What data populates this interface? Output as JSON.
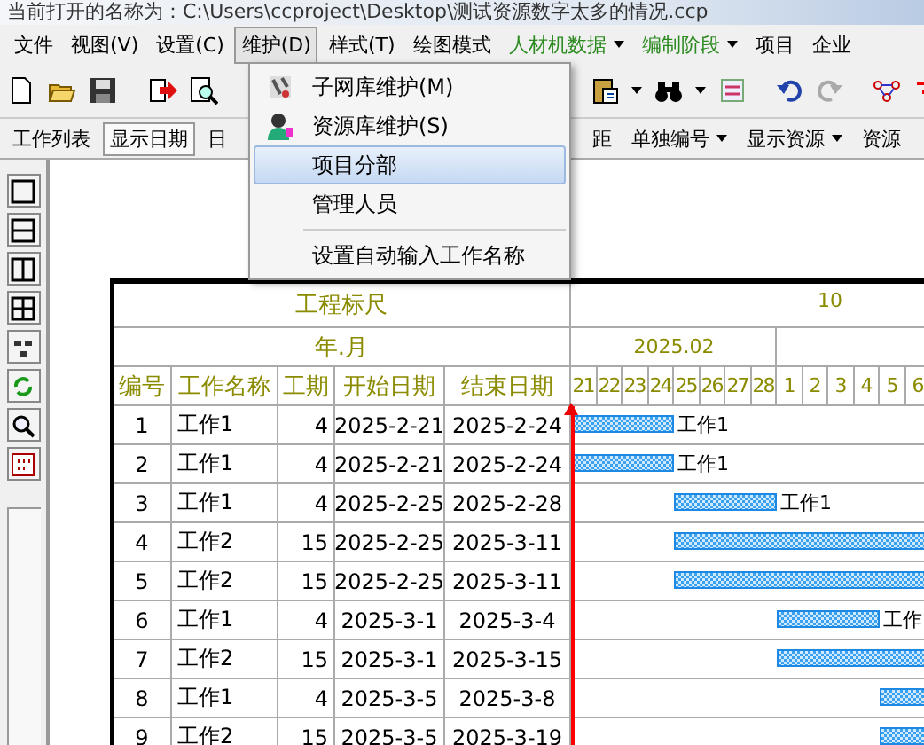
{
  "window": {
    "title": "当前打开的名称为：C:\\Users\\ccproject\\Desktop\\测试资源数字太多的情况.ccp"
  },
  "menubar": [
    {
      "label": "文件",
      "color": "#000000",
      "dropdown": false,
      "open": false
    },
    {
      "label": "视图(V)",
      "color": "#000000",
      "dropdown": false,
      "open": false
    },
    {
      "label": "设置(C)",
      "color": "#000000",
      "dropdown": false,
      "open": false
    },
    {
      "label": "维护(D)",
      "color": "#000000",
      "dropdown": false,
      "open": true
    },
    {
      "label": "样式(T)",
      "color": "#000000",
      "dropdown": false,
      "open": false
    },
    {
      "label": "绘图模式",
      "color": "#000000",
      "dropdown": false,
      "open": false
    },
    {
      "label": "人材机数据",
      "color": "#2a8a1e",
      "dropdown": true,
      "open": false
    },
    {
      "label": "编制阶段",
      "color": "#2a8a1e",
      "dropdown": true,
      "open": false
    },
    {
      "label": "项目",
      "color": "#000000",
      "dropdown": false,
      "open": false
    },
    {
      "label": "企业",
      "color": "#000000",
      "dropdown": false,
      "open": false
    }
  ],
  "toolbar2": [
    {
      "label": "工作列表",
      "pressed": false,
      "dropdown": false
    },
    {
      "label": "显示日期",
      "pressed": true,
      "dropdown": false
    },
    {
      "label": "日",
      "pressed": false,
      "dropdown": false
    },
    {
      "label": "距",
      "pressed": false,
      "dropdown": false
    },
    {
      "label": "单独编号",
      "pressed": false,
      "dropdown": true
    },
    {
      "label": "显示资源",
      "pressed": false,
      "dropdown": true
    },
    {
      "label": "资源",
      "pressed": false,
      "dropdown": false
    }
  ],
  "menu": [
    {
      "kind": "item",
      "label": "子网库维护(M)",
      "selected": false
    },
    {
      "kind": "item",
      "label": "资源库维护(S)",
      "selected": false
    },
    {
      "kind": "item",
      "label": "项目分部",
      "selected": true
    },
    {
      "kind": "item",
      "label": "管理人员",
      "selected": false
    },
    {
      "kind": "separator"
    },
    {
      "kind": "item",
      "label": "设置自动输入工作名称",
      "selected": false
    }
  ],
  "gantt": {
    "ruler_title": "工程标尺",
    "ruler_labels": [
      "10"
    ],
    "month_title": "年.月",
    "columns": [
      "编号",
      "工作名称",
      "工期",
      "开始日期",
      "结束日期"
    ],
    "months": [
      {
        "label": "2025.02",
        "days": [
          "21",
          "22",
          "23",
          "24",
          "25",
          "26",
          "27",
          "28"
        ]
      },
      {
        "days": [
          "1",
          "2",
          "3",
          "4",
          "5",
          "6"
        ]
      }
    ],
    "rows": [
      {
        "no": "1",
        "name": "工作1",
        "duration": "4",
        "start": "2025-2-21",
        "end": "2025-2-24",
        "bar_label": "工作1"
      },
      {
        "no": "2",
        "name": "工作1",
        "duration": "4",
        "start": "2025-2-21",
        "end": "2025-2-24",
        "bar_label": "工作1"
      },
      {
        "no": "3",
        "name": "工作1",
        "duration": "4",
        "start": "2025-2-25",
        "end": "2025-2-28",
        "bar_label": "工作1"
      },
      {
        "no": "4",
        "name": "工作2",
        "duration": "15",
        "start": "2025-2-25",
        "end": "2025-3-11"
      },
      {
        "no": "5",
        "name": "工作2",
        "duration": "15",
        "start": "2025-2-25",
        "end": "2025-3-11"
      },
      {
        "no": "6",
        "name": "工作1",
        "duration": "4",
        "start": "2025-3-1",
        "end": "2025-3-4",
        "bar_label": "工作"
      },
      {
        "no": "7",
        "name": "工作2",
        "duration": "15",
        "start": "2025-3-1",
        "end": "2025-3-15"
      },
      {
        "no": "8",
        "name": "工作1",
        "duration": "4",
        "start": "2025-3-5",
        "end": "2025-3-8"
      },
      {
        "no": "9",
        "name": "工作2",
        "duration": "15",
        "start": "2025-3-5",
        "end": "2025-3-19"
      }
    ]
  }
}
